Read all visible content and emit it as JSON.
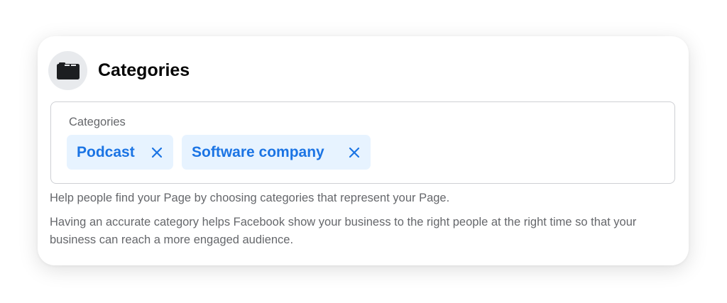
{
  "section": {
    "title": "Categories",
    "icon": "briefcase-icon"
  },
  "field": {
    "label": "Categories",
    "chips": [
      {
        "label": "Podcast",
        "remove_icon": "close-icon"
      },
      {
        "label": "Software company",
        "remove_icon": "close-icon"
      }
    ]
  },
  "help": {
    "line1": "Help people find your Page by choosing categories that represent your Page.",
    "line2": "Having an accurate category helps Facebook show your business to the right people at the right time so that your business can reach a more engaged audience."
  },
  "colors": {
    "accent": "#1b74e4",
    "chip_bg": "#e7f3ff",
    "secondary_text": "#65676b",
    "primary_text": "#050505"
  }
}
